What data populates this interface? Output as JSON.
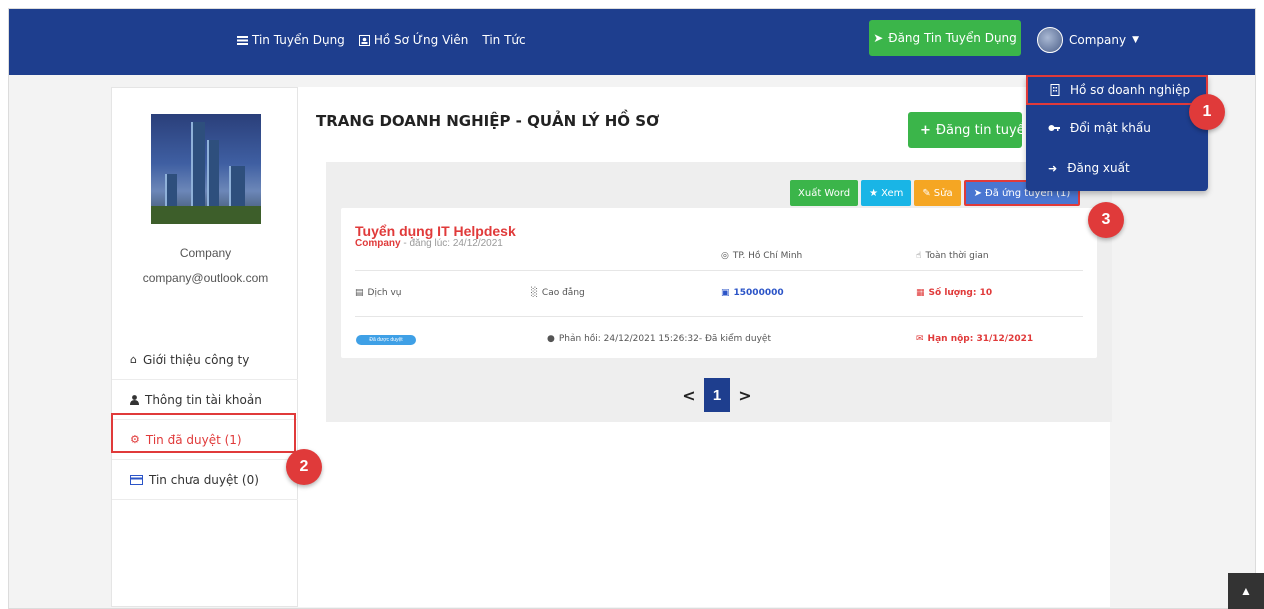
{
  "navbar": {
    "links": [
      {
        "label": "Tin Tuyển Dụng",
        "icon": "list-icon"
      },
      {
        "label": "Hồ Sơ Ứng Viên",
        "icon": "id-card-icon"
      },
      {
        "label": "Tin Tức",
        "icon": ""
      }
    ],
    "post_button": "Đăng Tin Tuyển Dụng",
    "account_label": "Company",
    "dropdown": [
      {
        "label": "Hồ sơ doanh nghiệp",
        "icon": "building-icon"
      },
      {
        "label": "Đổi mật khẩu",
        "icon": "key-icon"
      },
      {
        "label": "Đăng xuất",
        "icon": "logout-icon"
      }
    ]
  },
  "sidebar": {
    "company_name": "Company",
    "email": "company@outlook.com",
    "items": [
      {
        "label": "Giới thiệu công ty",
        "icon": "home-icon"
      },
      {
        "label": "Thông tin tài khoản",
        "icon": "user-icon"
      },
      {
        "label": "Tin đã duyệt (1)",
        "icon": "gear-icon"
      },
      {
        "label": "Tin chưa duyệt (0)",
        "icon": "card-icon"
      }
    ]
  },
  "main": {
    "title": "TRANG DOANH NGHIỆP - QUẢN LÝ HỒ SƠ",
    "add_button": "Đăng tin tuyển dụng",
    "actions": {
      "export_word": "Xuất Word",
      "view": "Xem",
      "edit": "Sửa",
      "applied": "Đã ứng tuyển (1)"
    },
    "job": {
      "title": "Tuyển dụng IT Helpdesk",
      "company": "Company",
      "posted": " - đăng lúc: 24/12/2021",
      "location": "TP. Hồ Chí Minh",
      "job_type": "Toàn thời gian",
      "category": "Dịch vụ",
      "education": "Cao đẳng",
      "salary": "15000000",
      "quantity": "Số lượng: 10",
      "status_badge": "Đã được duyệt",
      "feedback": "Phản hồi: 24/12/2021 15:26:32- Đã kiểm duyệt",
      "deadline": "Hạn nộp: 31/12/2021"
    },
    "pagination": {
      "prev": "<",
      "current": "1",
      "next": ">"
    }
  },
  "markers": [
    "1",
    "2",
    "3"
  ],
  "colors": {
    "navbar": "#1e3e8e",
    "green": "#3bb54a",
    "red": "#e03a3a",
    "cyan": "#19b5e6",
    "orange": "#f5a623",
    "blue": "#4a76d1"
  }
}
